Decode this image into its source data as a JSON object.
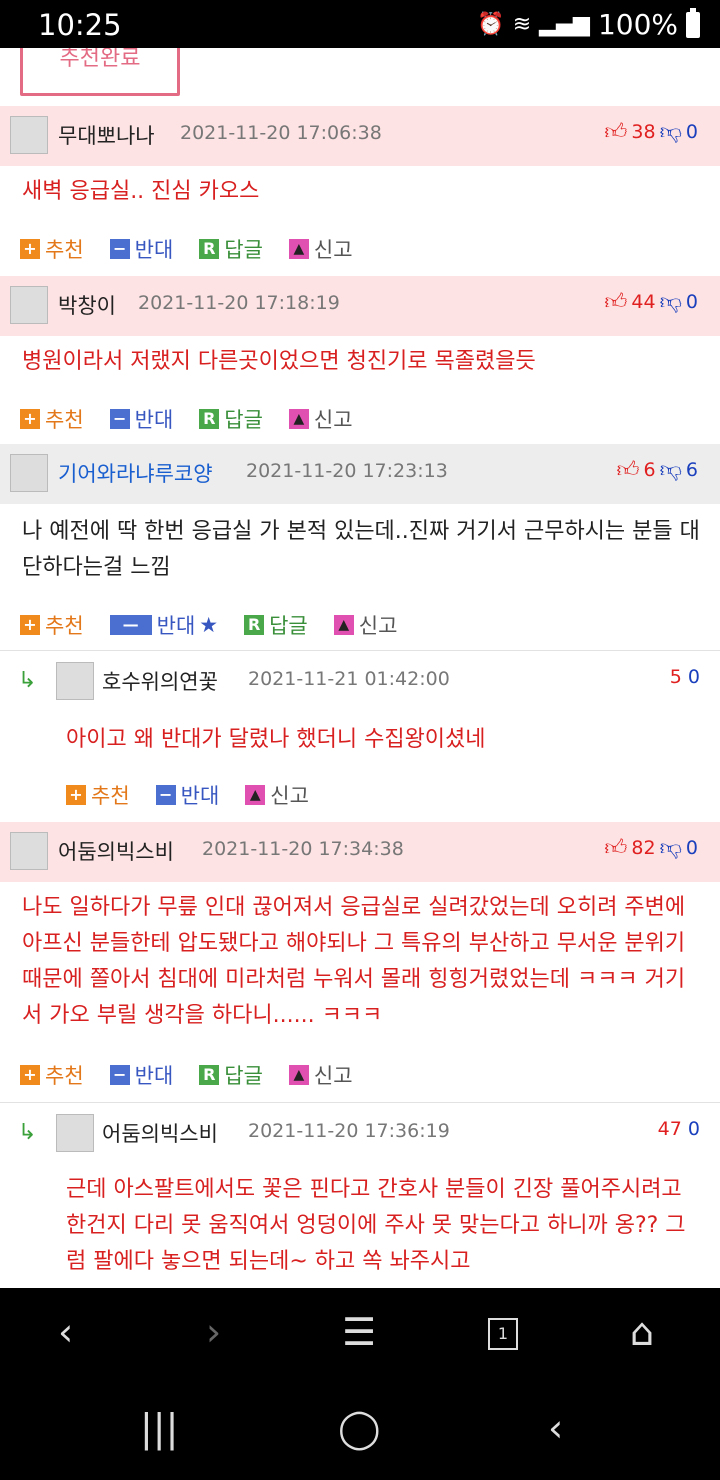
{
  "status_bar": {
    "time": "10:25",
    "battery": "100%"
  },
  "recommend_done": "추천완료",
  "comments": [
    {
      "nick": "무대뽀나나",
      "date": "2021-11-20 17:06:38",
      "up": "38",
      "down": "0",
      "text": "새벽 응급실.. 진심 카오스",
      "rec": "추천",
      "opp": "반대",
      "reply": "답글",
      "report": "신고"
    },
    {
      "nick": "박창이",
      "date": "2021-11-20 17:18:19",
      "up": "44",
      "down": "0",
      "text": "병원이라서 저랬지 다른곳이었으면 청진기로 목졸렸을듯",
      "rec": "추천",
      "opp": "반대",
      "reply": "답글",
      "report": "신고"
    },
    {
      "nick": "기어와라냐루코양",
      "date": "2021-11-20 17:23:13",
      "up": "6",
      "down": "6",
      "text": "나 예전에 딱 한번 응급실 가 본적 있는데..진짜 거기서 근무하시는 분들 대단하다는걸 느낌",
      "rec": "추천",
      "opp": "반대",
      "star": "★",
      "reply": "답글",
      "report": "신고"
    },
    {
      "nick": "어둠의빅스비",
      "date": "2021-11-20 17:34:38",
      "up": "82",
      "down": "0",
      "text": "나도 일하다가 무릎 인대 끊어져서 응급실로 실려갔었는데 오히려 주변에 아프신 분들한테 압도됐다고 해야되나 그 특유의 부산하고 무서운 분위기 때문에 쫄아서 침대에 미라처럼 누워서 몰래 힝힝거렸었는데 ㅋㅋㅋ 거기서 가오 부릴 생각을 하다니...... ㅋㅋㅋ",
      "rec": "추천",
      "opp": "반대",
      "reply": "답글",
      "report": "신고"
    }
  ],
  "replies": [
    {
      "nick": "호수위의연꽃",
      "date": "2021-11-21 01:42:00",
      "up": "5",
      "down": "0",
      "text": "아이고 왜 반대가 달렸나 했더니 수집왕이셨네",
      "rec": "추천",
      "opp": "반대",
      "report": "신고"
    },
    {
      "nick": "어둠의빅스비",
      "date": "2021-11-20 17:36:19",
      "up": "47",
      "down": "0",
      "text": "근데 아스팔트에서도 꽃은 핀다고 간호사 분들이 긴장 풀어주시려고 한건지 다리 못 움직여서 엉덩이에 주사 못 맞는다고 하니까 옹?? 그럼 팔에다 놓으면 되는데~ 하고 쏙 놔주시고"
    }
  ],
  "browser_nav": {
    "tab_count": "1"
  },
  "colors": {
    "pink_header": "#fde3e3",
    "gray_header": "#ededed",
    "red_text": "#d82020",
    "up_red": "#e02020",
    "down_blue": "#1a3fbd"
  }
}
